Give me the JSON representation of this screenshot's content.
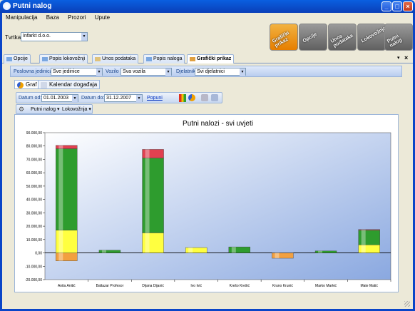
{
  "window": {
    "title": "Putni nalog"
  },
  "menu": [
    "Manipulacija",
    "Baza",
    "Prozori",
    "Upute"
  ],
  "company": {
    "label": "Tvrtka :",
    "value": "Infarkt d.o.o."
  },
  "quick_buttons": [
    "Grafički prikaz",
    "Opcije",
    "Unos podataka",
    "Lokovožnja",
    "Putni nalog"
  ],
  "tabs": [
    "Opcije",
    "Popis lokovožnji",
    "Unos podataka",
    "Popis naloga",
    "Grafički prikaz"
  ],
  "filters": {
    "unit_label": "Poslovna jedinica",
    "unit_value": "Sve jedinice",
    "vehicle_label": "Vozilo",
    "vehicle_value": "Sva vozila",
    "employee_label": "Djelatnik",
    "employee_value": "Svi djelatnici"
  },
  "subtabs": [
    "Graf",
    "Kalendar događaja"
  ],
  "dates": {
    "from_label": "Datum od:",
    "from_value": "01.01.2003",
    "to_label": "Datum do:",
    "to_value": "31.12.2007",
    "fill_link": "Popuni"
  },
  "toolbar2": [
    "Putni nalog",
    "Lokovožnja"
  ],
  "chart_data": {
    "type": "bar",
    "title": "Putni nalozi - svi uvjeti",
    "categories": [
      "Anita Anitić",
      "Baltazar Profesor",
      "Dijana Dijanić",
      "Ivo Ivić",
      "Krešo Krešić",
      "Kruno Krunić",
      "Marko Markić",
      "Mate Matić"
    ],
    "ylim": [
      -20000,
      90000
    ],
    "yticks": [
      "90.000,00",
      "80.000,00",
      "70.000,00",
      "60.000,00",
      "50.000,00",
      "40.000,00",
      "30.000,00",
      "20.000,00",
      "10.000,00",
      "0,00",
      "-10.000,00",
      "-20.000,00"
    ],
    "tick_values": [
      90000,
      80000,
      70000,
      60000,
      50000,
      40000,
      30000,
      20000,
      10000,
      0,
      -10000,
      -20000
    ],
    "series": [
      {
        "color": "#f2a040",
        "values": [
          -6000,
          0,
          0,
          0,
          0,
          -4000,
          0,
          0
        ]
      },
      {
        "color": "#ffff40",
        "values": [
          17000,
          0,
          15000,
          4000,
          0,
          0,
          0,
          6000
        ]
      },
      {
        "color": "#2e9c2e",
        "values": [
          61000,
          2000,
          56000,
          0,
          4500,
          0,
          1500,
          11000
        ]
      },
      {
        "color": "#e04050",
        "values": [
          2500,
          0,
          6500,
          0,
          0,
          0,
          0,
          500
        ]
      }
    ],
    "grid": false
  }
}
